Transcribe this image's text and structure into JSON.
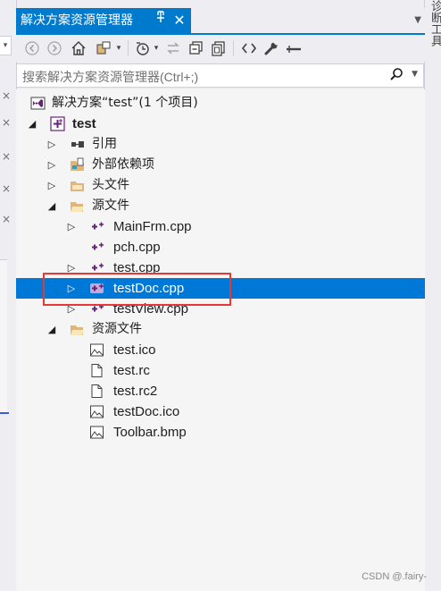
{
  "window": {
    "tab_title": "解决方案资源管理器",
    "pin_glyph": "ᆂ",
    "close_glyph": "✕",
    "right_panel_tab": "诊断工具"
  },
  "toolbar": {
    "buttons": [
      "back",
      "forward",
      "home",
      "switch-views",
      "history",
      "sync",
      "collapse-all",
      "show-all-files",
      "view-code",
      "properties",
      "pending-changes-filter"
    ]
  },
  "search": {
    "placeholder": "搜索解决方案资源管理器(Ctrl+;)"
  },
  "tree": {
    "solution": "解决方案“test”(1 个项目)",
    "project": "test",
    "references": "引用",
    "external_deps": "外部依赖项",
    "header_files": "头文件",
    "source_files": "源文件",
    "sources": [
      "MainFrm.cpp",
      "pch.cpp",
      "test.cpp",
      "testDoc.cpp",
      "testView.cpp"
    ],
    "resource_files": "资源文件",
    "resources": [
      "test.ico",
      "test.rc",
      "test.rc2",
      "testDoc.ico",
      "Toolbar.bmp"
    ],
    "selected": "testDoc.cpp"
  },
  "colors": {
    "accent": "#007acc",
    "selection": "#0078d7",
    "highlight_box": "#e53935"
  },
  "watermark": "CSDN @.fairy-"
}
